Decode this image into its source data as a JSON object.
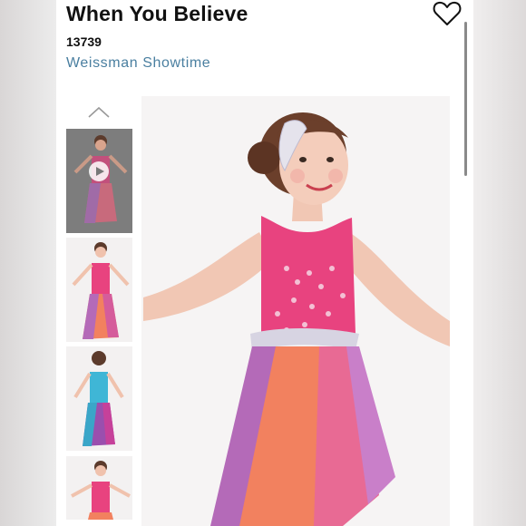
{
  "product": {
    "title": "When You Believe",
    "sku": "13739",
    "brand": "Weissman Showtime"
  },
  "icons": {
    "favorite": "heart-outline-icon",
    "gallery_up": "chevron-up-icon",
    "video": "play-icon"
  },
  "colors": {
    "brand_link": "#4a7fa0",
    "dress_pink": "#e8437f",
    "skirt_orange": "#f2815f",
    "skirt_purple": "#b46ab8",
    "alt_dress_teal": "#3fb6d6"
  },
  "gallery": {
    "thumbnails": [
      {
        "label": "video",
        "selected": true
      },
      {
        "label": "front"
      },
      {
        "label": "back"
      },
      {
        "label": "front-2"
      }
    ]
  }
}
